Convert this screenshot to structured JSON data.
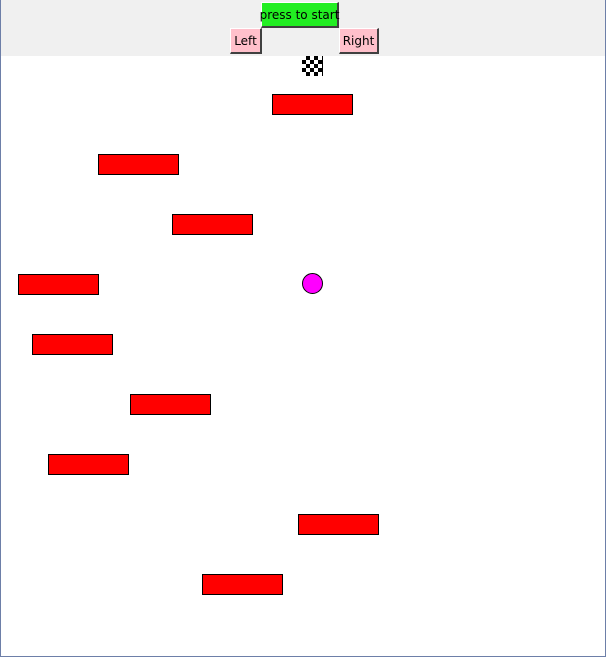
{
  "controls": {
    "start_label": "press to start",
    "left_label": "Left",
    "right_label": "Right"
  },
  "colors": {
    "start_button": "#22ee22",
    "direction_buttons": "#ffc0cb",
    "platform": "#ff0000",
    "ball": "#ff00ff",
    "toolbar_background": "#f0f0f0",
    "game_background": "#ffffff"
  },
  "game": {
    "goal_icon": "checkered-flag-icon",
    "platform_count": 9,
    "ball_shape": "circle"
  }
}
